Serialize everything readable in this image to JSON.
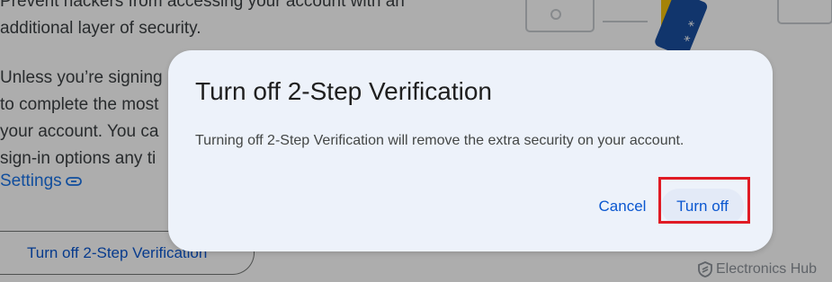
{
  "background": {
    "paragraph1": [
      "Prevent hackers from accessing your account with an",
      "additional layer of security."
    ],
    "paragraph2": [
      "Unless you’re signing",
      "to complete the most",
      "your account. You ca",
      "sign-in options any ti"
    ],
    "settings_link": "Settings",
    "turn_off_button": "Turn off 2-Step Verification"
  },
  "dialog": {
    "title": "Turn off 2-Step Verification",
    "body": "Turning off 2-Step Verification will remove the extra security on your account.",
    "cancel_label": "Cancel",
    "turn_off_label": "Turn off"
  },
  "watermark": {
    "text": "Electronics Hub"
  },
  "colors": {
    "accent": "#0b57d0",
    "dialog_bg": "#edf2fa",
    "highlight": "#e01b24"
  }
}
